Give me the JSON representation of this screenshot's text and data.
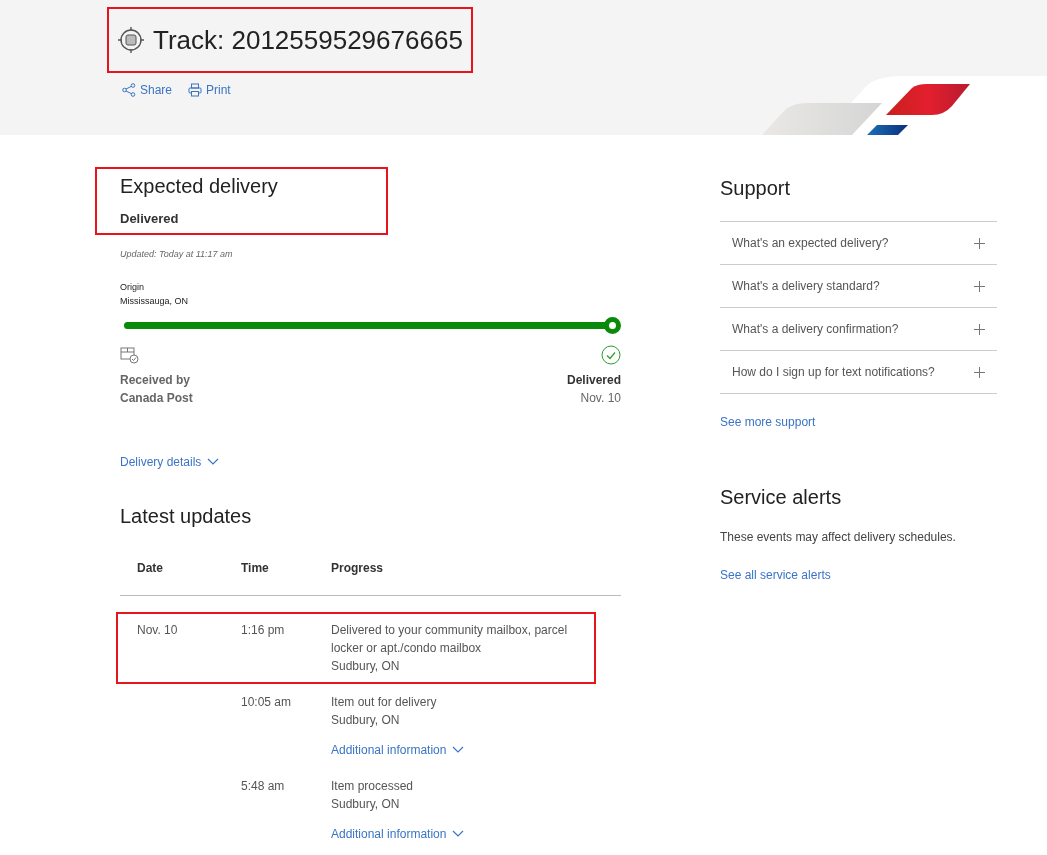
{
  "header": {
    "title": "Track: 2012559529676665",
    "highlighted": true,
    "actions": [
      {
        "kind": "share",
        "label": "Share"
      },
      {
        "kind": "print",
        "label": "Print"
      }
    ]
  },
  "expected": {
    "heading": "Expected delivery",
    "status": "Delivered",
    "highlighted": true,
    "updated": "Updated: Today at 11:17 am"
  },
  "origin": {
    "label": "Origin",
    "place": "Mississauga, ON"
  },
  "progress": {
    "level": 1
  },
  "start": {
    "lines": [
      "Received by",
      "Canada Post"
    ]
  },
  "end": {
    "status": "Delivered",
    "date": "Nov. 10"
  },
  "delivery_details": {
    "label": "Delivery details",
    "expanded": false
  },
  "updates": {
    "heading": "Latest updates",
    "columns": [
      "Date",
      "Time",
      "Progress"
    ],
    "rows": [
      {
        "date": "Nov. 10",
        "time": "1:16 pm",
        "progress": "Delivered to your community mailbox, parcel locker or apt./condo mailbox",
        "location": "Sudbury, ON",
        "highlighted": true
      },
      {
        "time": "10:05 am",
        "progress": "Item out for delivery",
        "location": "Sudbury, ON",
        "more": "Additional information",
        "highlighted": false
      },
      {
        "time": "5:48 am",
        "progress": "Item processed",
        "location": "Sudbury, ON",
        "more": "Additional information",
        "highlighted": false
      }
    ]
  },
  "support": {
    "heading": "Support",
    "items": [
      {
        "question": "What's an expected delivery?",
        "expanded": false
      },
      {
        "question": "What's a delivery standard?",
        "expanded": false
      },
      {
        "question": "What's a delivery confirmation?",
        "expanded": false
      },
      {
        "question": "How do I sign up for text notifications?",
        "expanded": false
      }
    ],
    "link": "See more support"
  },
  "alerts": {
    "heading": "Service alerts",
    "text": "These events may affect delivery schedules.",
    "link": "See all service alerts"
  }
}
